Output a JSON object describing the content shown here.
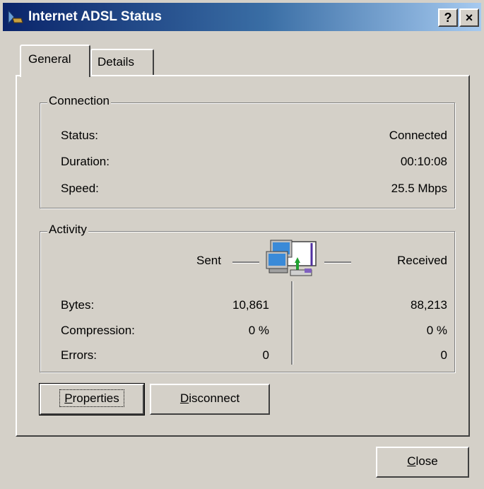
{
  "window": {
    "title": "Internet ADSL Status",
    "help_button": "?",
    "close_button": "×"
  },
  "tabs": [
    {
      "label": "General",
      "selected": true
    },
    {
      "label": "Details",
      "selected": false
    }
  ],
  "connection": {
    "legend": "Connection",
    "rows": [
      {
        "label": "Status:",
        "value": "Connected"
      },
      {
        "label": "Duration:",
        "value": "00:10:08"
      },
      {
        "label": "Speed:",
        "value": "25.5 Mbps"
      }
    ]
  },
  "activity": {
    "legend": "Activity",
    "sent_label": "Sent",
    "received_label": "Received",
    "icon": "network-computers-icon",
    "rows": [
      {
        "label": "Bytes:",
        "sent": "10,861",
        "received": "88,213"
      },
      {
        "label": "Compression:",
        "sent": "0 %",
        "received": "0 %"
      },
      {
        "label": "Errors:",
        "sent": "0",
        "received": "0"
      }
    ]
  },
  "buttons": {
    "properties": {
      "accel": "P",
      "rest": "roperties"
    },
    "disconnect": {
      "accel": "D",
      "rest": "isconnect"
    },
    "close": {
      "accel": "C",
      "rest": "lose"
    }
  },
  "colors": {
    "titlebar_start": "#0a246a",
    "titlebar_end": "#a6caf0",
    "face": "#d4d0c8"
  }
}
